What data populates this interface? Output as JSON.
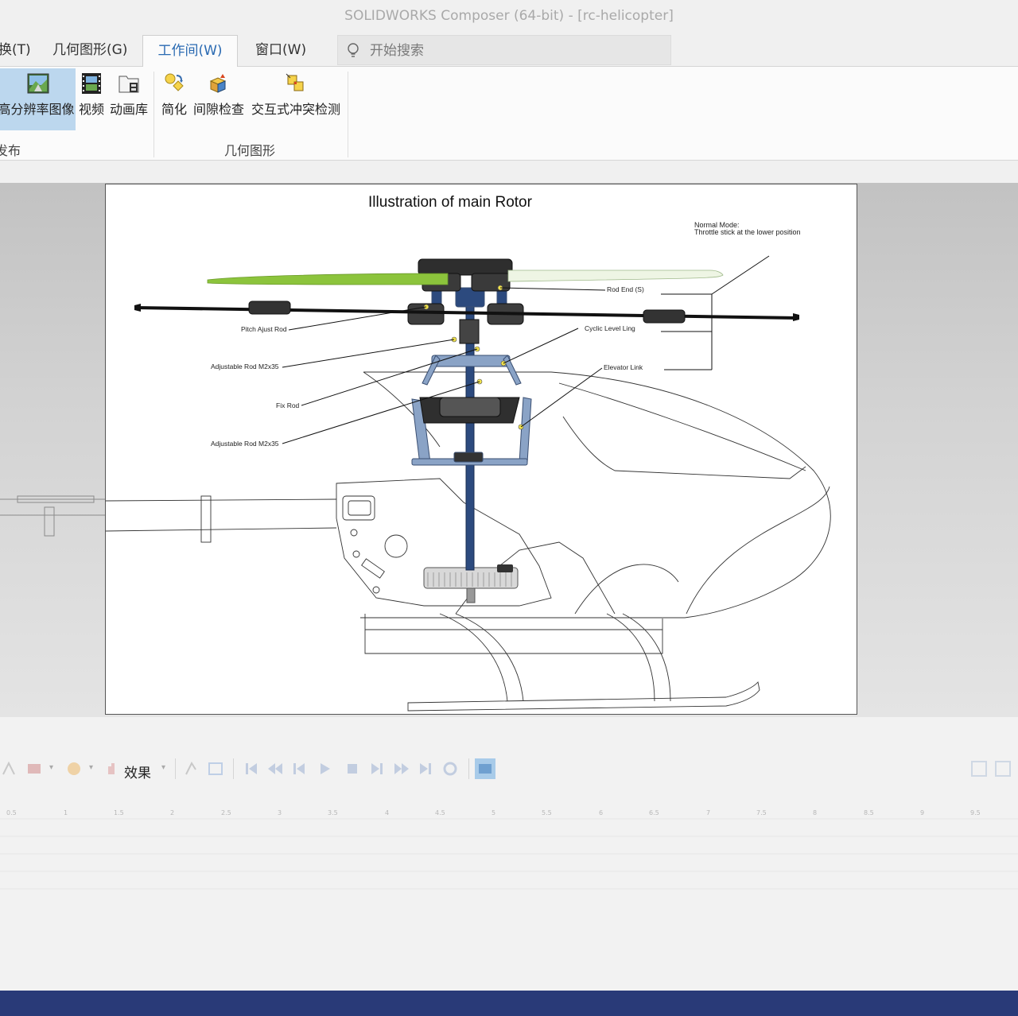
{
  "window": {
    "title": "SOLIDWORKS Composer (64-bit) - [rc-helicopter]"
  },
  "tabs": [
    {
      "label": "换(T)",
      "name": "tab-transform"
    },
    {
      "label": "几何图形(G)",
      "name": "tab-geometry"
    },
    {
      "label": "工作间(W)",
      "name": "tab-workshops",
      "active": true
    },
    {
      "label": "窗口(W)",
      "name": "tab-window"
    }
  ],
  "search": {
    "placeholder": "开始搜索"
  },
  "ribbon": {
    "groups": [
      {
        "label": "发布",
        "buttons": [
          "高分辨率图像",
          "视频",
          "动画库"
        ]
      },
      {
        "label": "几何图形",
        "buttons": [
          "简化",
          "间隙检查",
          "交互式冲突检测"
        ]
      }
    ]
  },
  "sheet": {
    "title": "Illustration of main Rotor",
    "note_line1": "Normal Mode:",
    "note_line2": "Throttle stick at the lower position",
    "callouts": [
      "Rod End (S)",
      "Pitch Ajust Rod",
      "Cyclic Level Ling",
      "Adjustable Rod M2x35",
      "Elevator Link",
      "Fix Rod",
      "Adjustable Rod M2x35"
    ]
  },
  "animation_toolbar": {
    "effects_label": "效果"
  },
  "timeline": {
    "ticks": [
      "0.5",
      "1",
      "1.5",
      "2",
      "2.5",
      "3",
      "3.5",
      "4",
      "4.5",
      "5",
      "5.5",
      "6",
      "6.5",
      "7",
      "7.5",
      "8",
      "8.5",
      "9",
      "9.5"
    ]
  },
  "colors": {
    "accent": "#2a6ab2",
    "selected_button": "#bcd7ee",
    "footer": "#293a78"
  }
}
